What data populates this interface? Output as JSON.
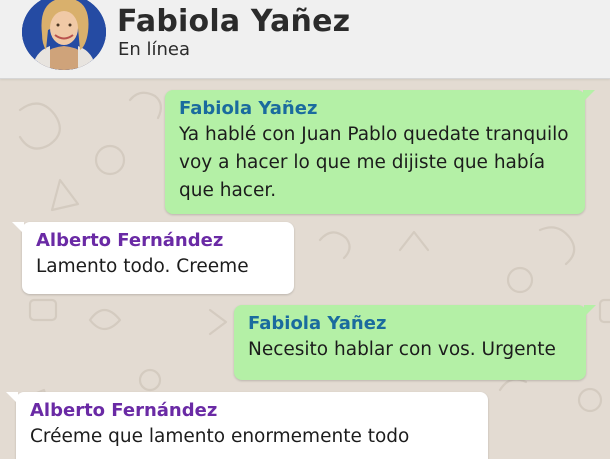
{
  "header": {
    "contact_name": "Fabiola Yañez",
    "status": "En línea"
  },
  "messages": [
    {
      "direction": "outgoing",
      "sender": "Fabiola Yañez",
      "lines": [
        "Ya hablé con Juan Pablo quedate tranquilo",
        "voy a hacer lo que me dijiste que había",
        "que hacer."
      ]
    },
    {
      "direction": "incoming",
      "sender": "Alberto Fernández",
      "lines": [
        "Lamento todo. Creeme"
      ]
    },
    {
      "direction": "outgoing",
      "sender": "Fabiola Yañez",
      "lines": [
        "Necesito hablar con vos. Urgente"
      ]
    },
    {
      "direction": "incoming",
      "sender": "Alberto Fernández",
      "lines": [
        "Créeme que lamento enormemente todo"
      ]
    }
  ],
  "colors": {
    "outgoing_bubble": "#b4f0a6",
    "incoming_bubble": "#ffffff",
    "sender_fabiola": "#1a6b9e",
    "sender_alberto": "#6a2aa5",
    "chat_background": "#e3dbd2",
    "header_background": "#f0f0f0"
  }
}
